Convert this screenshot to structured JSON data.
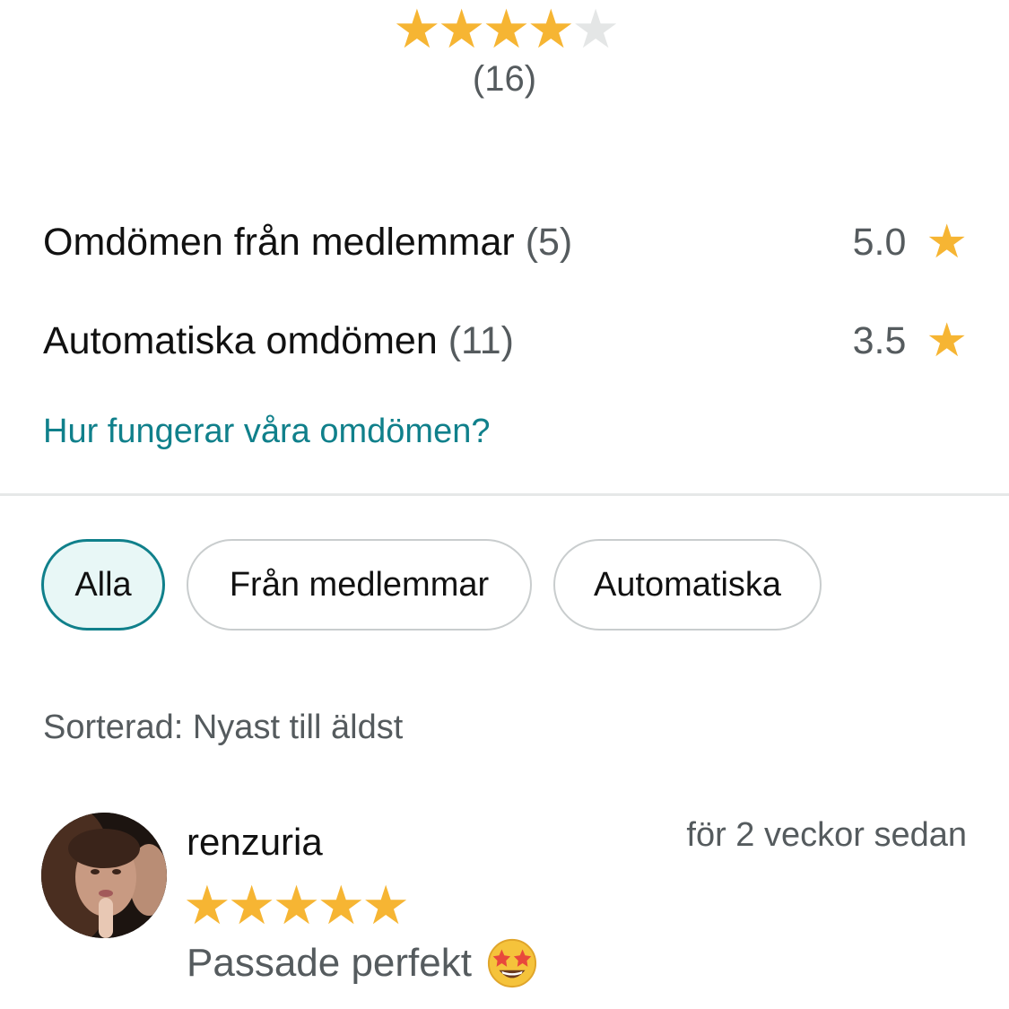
{
  "overall": {
    "rating": 4,
    "max": 5,
    "count_text": "(16)"
  },
  "member_reviews": {
    "label": "Omdömen från medlemmar",
    "count": "(5)",
    "score": "5.0"
  },
  "auto_reviews": {
    "label": "Automatiska omdömen",
    "count": "(11)",
    "score": "3.5"
  },
  "help_link": "Hur fungerar våra omdömen?",
  "filters": [
    {
      "label": "Alla",
      "active": true
    },
    {
      "label": "Från medlemmar",
      "active": false
    },
    {
      "label": "Automatiska",
      "active": false
    }
  ],
  "sort_text": "Sorterad: Nyast till äldst",
  "review": {
    "username": "renzuria",
    "time": "för 2 veckor sedan",
    "rating": 5,
    "text": "Passade perfekt",
    "emoji": "star-struck-emoji"
  },
  "colors": {
    "star": "#f6b533",
    "star_empty": "#e4e6e6",
    "accent": "#10808b",
    "muted_text": "#555b5e"
  },
  "icons": {
    "star": "★"
  }
}
